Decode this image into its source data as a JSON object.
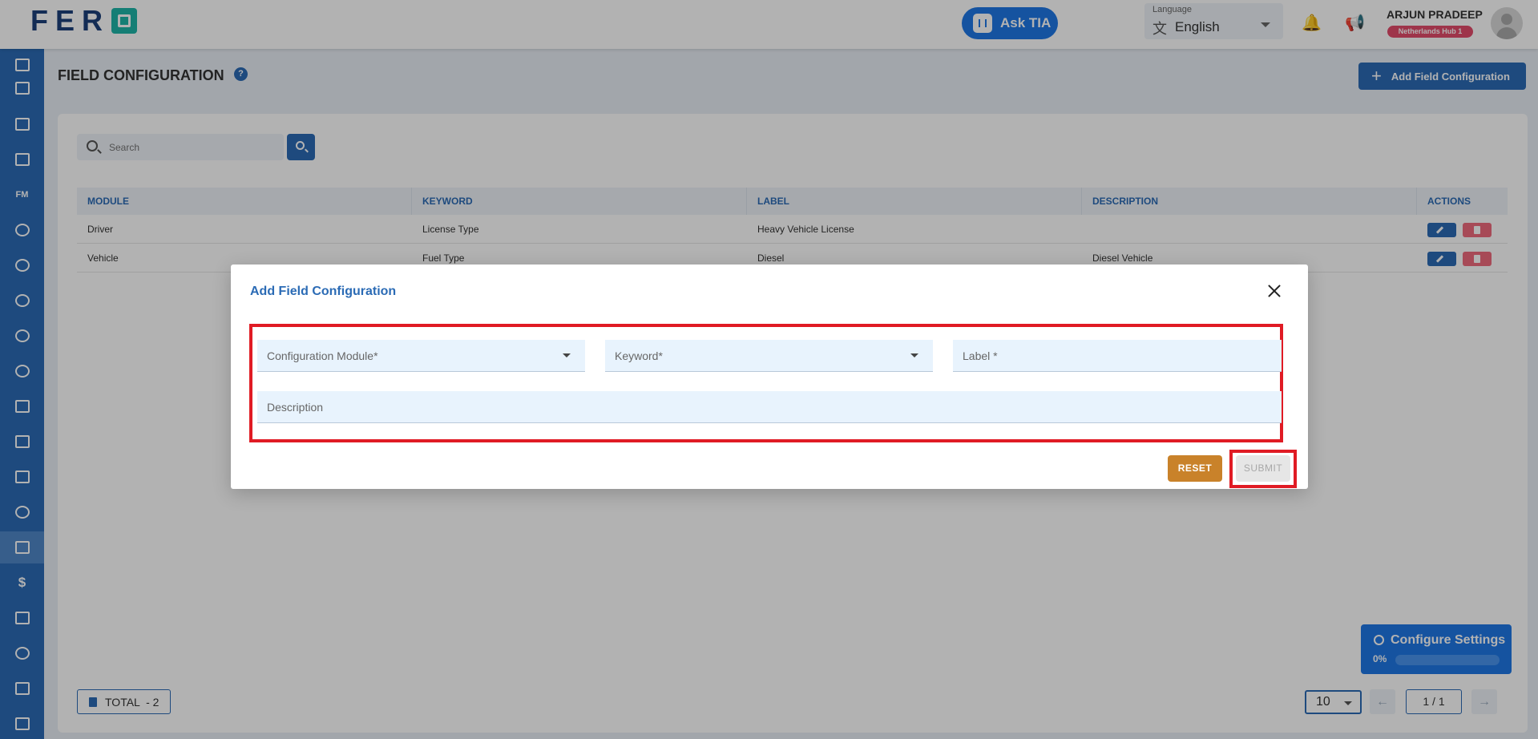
{
  "header": {
    "logo_text": "FER",
    "ask_tia_label": "Ask TIA",
    "language": {
      "label": "Language",
      "value": "English"
    },
    "user": {
      "name": "ARJUN PRADEEP",
      "hub": "Netherlands Hub 1"
    }
  },
  "sidebar": {
    "items": [
      {
        "id": "dashboard",
        "icon": "chart-icon"
      },
      {
        "id": "calendar",
        "icon": "calendar-icon"
      },
      {
        "id": "trucks",
        "icon": "truck-icon"
      },
      {
        "id": "inventory",
        "icon": "box-icon"
      },
      {
        "id": "fm",
        "label": "FM"
      },
      {
        "id": "users",
        "icon": "users-icon"
      },
      {
        "id": "info",
        "icon": "info-icon"
      },
      {
        "id": "groups",
        "icon": "group-icon"
      },
      {
        "id": "network",
        "icon": "globe-icon"
      },
      {
        "id": "settings",
        "icon": "gear-icon"
      },
      {
        "id": "routes",
        "icon": "branch-icon"
      },
      {
        "id": "parking",
        "icon": "parking-icon"
      },
      {
        "id": "warehouse",
        "icon": "warehouse-icon"
      },
      {
        "id": "teams",
        "icon": "team-icon"
      },
      {
        "id": "field-config",
        "icon": "table-gear-icon"
      },
      {
        "id": "billing",
        "icon": "dollar-icon"
      },
      {
        "id": "contacts",
        "icon": "id-card-icon"
      },
      {
        "id": "keys",
        "icon": "key-icon"
      },
      {
        "id": "archive",
        "icon": "archive-icon"
      },
      {
        "id": "notes",
        "icon": "edit-icon"
      }
    ]
  },
  "page": {
    "title": "FIELD CONFIGURATION",
    "help": "?",
    "add_button_label": "Add Field Configuration",
    "search_placeholder": "Search"
  },
  "table": {
    "columns": [
      "MODULE",
      "KEYWORD",
      "LABEL",
      "DESCRIPTION",
      "ACTIONS"
    ],
    "rows": [
      {
        "module": "Driver",
        "keyword": "License Type",
        "label": "Heavy Vehicle License",
        "description": ""
      },
      {
        "module": "Vehicle",
        "keyword": "Fuel Type",
        "label": "Diesel",
        "description": "Diesel Vehicle"
      }
    ]
  },
  "footer": {
    "total_label": "TOTAL  - 2",
    "page_size": "10",
    "page_indicator": "1 / 1",
    "prev": "←",
    "next": "→"
  },
  "configure_settings": {
    "title": "Configure Settings",
    "percent_label": "0%",
    "progress": 0
  },
  "modal": {
    "title": "Add Field Configuration",
    "fields": {
      "module_placeholder": "Configuration Module*",
      "keyword_placeholder": "Keyword*",
      "label_placeholder": "Label *",
      "description_placeholder": "Description"
    },
    "reset_label": "RESET",
    "submit_label": "SUBMIT"
  },
  "colors": {
    "primary": "#2b6bb5",
    "accent": "#1f78e6",
    "reset": "#c9822a",
    "delete": "#f06a7d",
    "highlight": "#e01b24"
  }
}
